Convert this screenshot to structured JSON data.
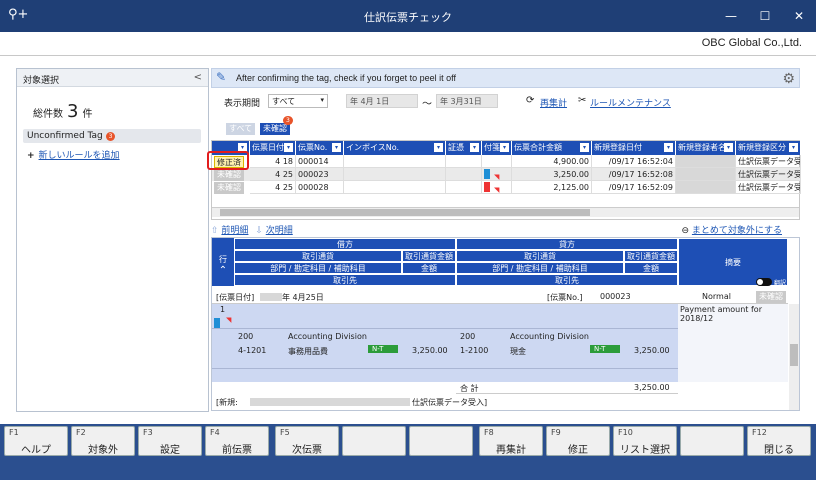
{
  "window": {
    "title": "仕訳伝票チェック",
    "minimize": "—",
    "maximize": "☐",
    "close": "✕"
  },
  "company": "OBC Global Co.,Ltd.",
  "left_panel": {
    "header": "対象選択",
    "collapse": "<",
    "count_label": "総件数",
    "count_value": "3",
    "count_unit": "件",
    "tag": {
      "label": "Unconfirmed Tag",
      "badge": "3"
    },
    "add_rule": "新しいルールを追加"
  },
  "info": {
    "message": "After confirming the tag, check if you forget to peel it off"
  },
  "filter": {
    "period_label": "表示期間",
    "period_value": "すべて",
    "date_from": "年 4月 1日",
    "tilde": "～",
    "date_to": "年 3月31日",
    "recalc": "再集計",
    "rule_maint": "ルールメンテナンス",
    "chip_all": "すべて",
    "chip_unconfirmed": "未確認",
    "chip_badge": "3"
  },
  "grid": {
    "columns": [
      "",
      "伝票日付",
      "伝票No.",
      "インボイスNo.",
      "証憑",
      "付箋",
      "伝票合計金額",
      "新規登録日付",
      "新規登録者名",
      "新規登録区分"
    ],
    "rows": [
      {
        "status": "修正済",
        "month": "4",
        "day": "18",
        "no": "000014",
        "total": "4,900.00",
        "reg_date": "/09/17 16:52:04",
        "reg_type": "仕訳伝票データ受入"
      },
      {
        "status": "未確認",
        "month": "4",
        "day": "25",
        "no": "000023",
        "total": "3,250.00",
        "reg_date": "/09/17 16:52:08",
        "reg_type": "仕訳伝票データ受入"
      },
      {
        "status": "未確認",
        "month": "4",
        "day": "25",
        "no": "000028",
        "total": "2,125.00",
        "reg_date": "/09/17 16:52:09",
        "reg_type": "仕訳伝票データ受入"
      }
    ]
  },
  "nav": {
    "prev": "前明細",
    "next": "次明細",
    "exclude_all": "まとめて対象外にする"
  },
  "detail": {
    "row_label": "行",
    "debit": "借方",
    "credit": "貸方",
    "currency": "取引通貨",
    "currency_amount": "取引通貨金額",
    "dept_account": "部門 / 勘定科目 / 補助科目",
    "amount": "金額",
    "partner": "取引先",
    "summary": "摘要",
    "toggle_label": "翻訳",
    "slip_date_label": "[伝票日付]",
    "slip_date_value": "年  4月25日",
    "slip_no_label": "[伝票No.]",
    "slip_no_value": "000023",
    "normal": "Normal",
    "unconfirmed": "未確認",
    "line_no": "1",
    "summary_text": "Payment amount for 2018/12",
    "debit_dept_code": "200",
    "debit_dept": "Accounting Division",
    "debit_acct_code": "4-1201",
    "debit_acct": "事務用品費",
    "debit_tax": "N-T",
    "debit_amount": "3,250.00",
    "credit_dept_code": "200",
    "credit_dept": "Accounting Division",
    "credit_acct_code": "1-2100",
    "credit_acct": "現金",
    "credit_tax": "N-T",
    "credit_amount": "3,250.00",
    "total_label": "合  計",
    "total_amount": "3,250.00",
    "new_label": "[新規:",
    "new_type": "仕訳伝票データ受入]"
  },
  "fkeys": [
    {
      "n": "F1",
      "l": "ヘルプ"
    },
    {
      "n": "F2",
      "l": "対象外"
    },
    {
      "n": "F3",
      "l": "設定"
    },
    {
      "n": "F4",
      "l": "前伝票"
    },
    {
      "n": "F5",
      "l": "次伝票"
    },
    {
      "n": "",
      "l": ""
    },
    {
      "n": "",
      "l": ""
    },
    {
      "n": "F8",
      "l": "再集計"
    },
    {
      "n": "F9",
      "l": "修正"
    },
    {
      "n": "F10",
      "l": "リスト選択"
    },
    {
      "n": "",
      "l": ""
    },
    {
      "n": "F12",
      "l": "閉じる"
    }
  ]
}
